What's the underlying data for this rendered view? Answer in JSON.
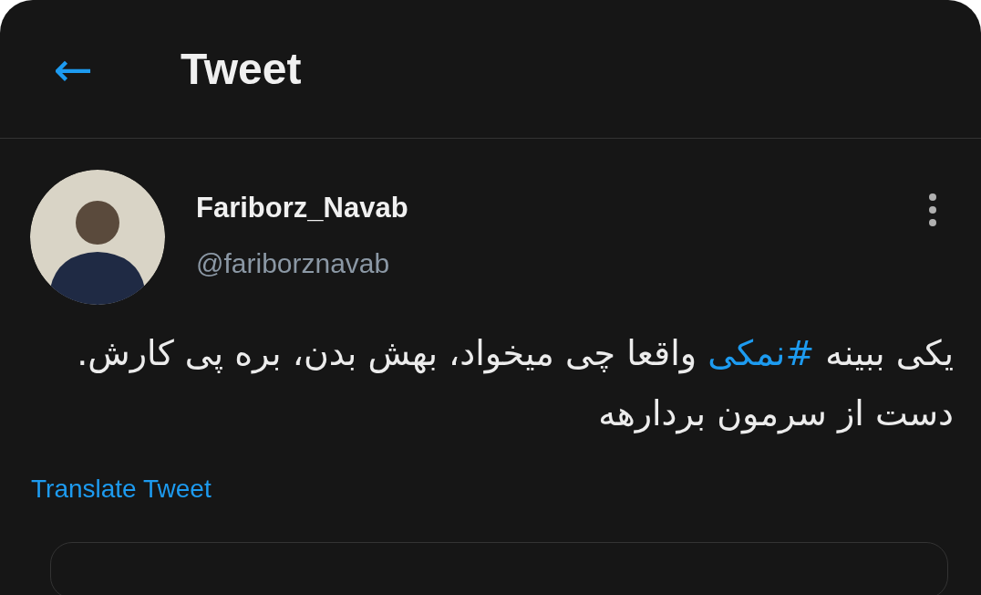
{
  "header": {
    "back": "←",
    "title": "Tweet"
  },
  "tweet": {
    "name": "Fariborz_Navab",
    "handle": "@fariborznavab",
    "text_before": "یکی ببینه ",
    "hashtag": "#نمکی",
    "text_after": " واقعا چی میخواد، بهش بدن، بره پی کارش. دست از سرمون بردارهه",
    "translate": "Translate Tweet"
  }
}
